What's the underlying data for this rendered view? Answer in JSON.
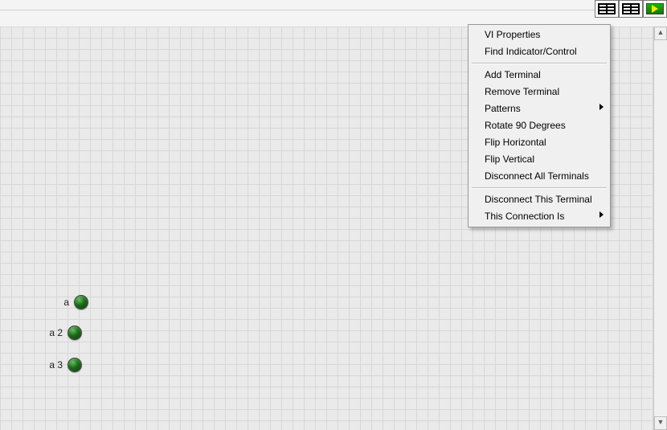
{
  "indicators": [
    {
      "label": "a"
    },
    {
      "label": "a 2"
    },
    {
      "label": "a 3"
    }
  ],
  "menu": {
    "group1": {
      "vi_properties": "VI Properties",
      "find": "Find Indicator/Control"
    },
    "group2": {
      "add_terminal": "Add Terminal",
      "remove_terminal": "Remove Terminal",
      "patterns": "Patterns",
      "rotate": "Rotate 90 Degrees",
      "flip_h": "Flip Horizontal",
      "flip_v": "Flip Vertical",
      "disconnect_all": "Disconnect All Terminals"
    },
    "group3": {
      "disconnect_this": "Disconnect This Terminal",
      "connection_is": "This Connection Is"
    }
  }
}
